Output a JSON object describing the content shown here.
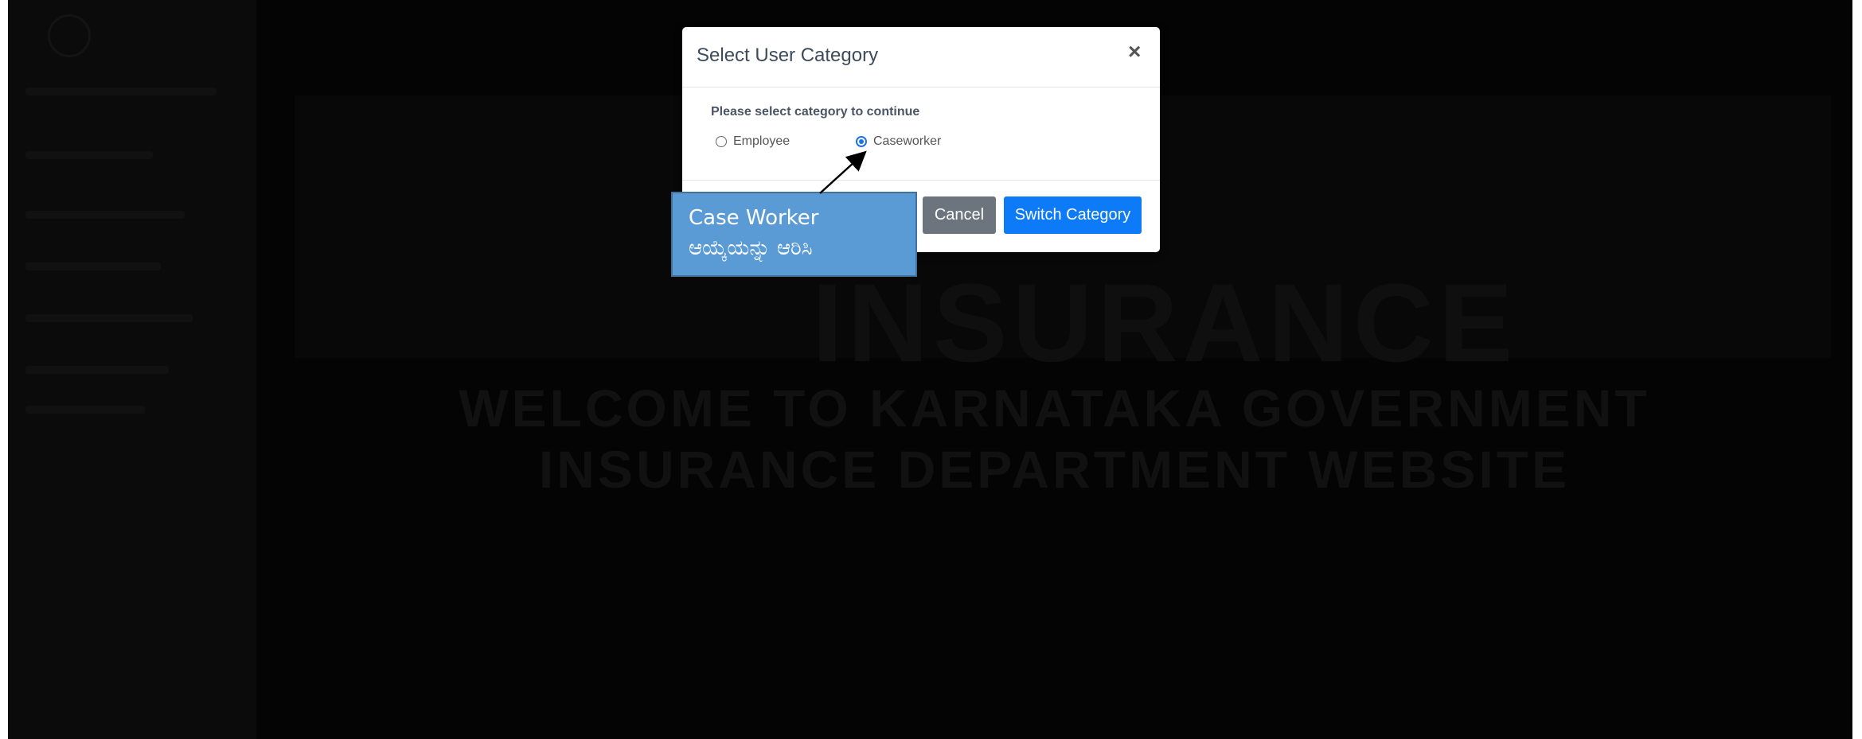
{
  "modal": {
    "title": "Select User Category",
    "close_icon": "×",
    "prompt": "Please select category to continue",
    "options": [
      {
        "label": "Employee",
        "selected": false
      },
      {
        "label": "Caseworker",
        "selected": true
      }
    ],
    "cancel_label": "Cancel",
    "switch_label": "Switch Category"
  },
  "callout": {
    "line1": "Case Worker",
    "line2": "ಆಯ್ಕೆಯನ್ನು ಆರಿಸಿ"
  },
  "background": {
    "banner_text": "INSURANCE",
    "welcome_line1": "WELCOME TO KARNATAKA GOVERNMENT",
    "welcome_line2": "INSURANCE DEPARTMENT WEBSITE"
  },
  "colors": {
    "primary": "#0d7bf7",
    "secondary": "#6c757d",
    "callout": "#5b9bd5",
    "overlay": "#040404"
  }
}
